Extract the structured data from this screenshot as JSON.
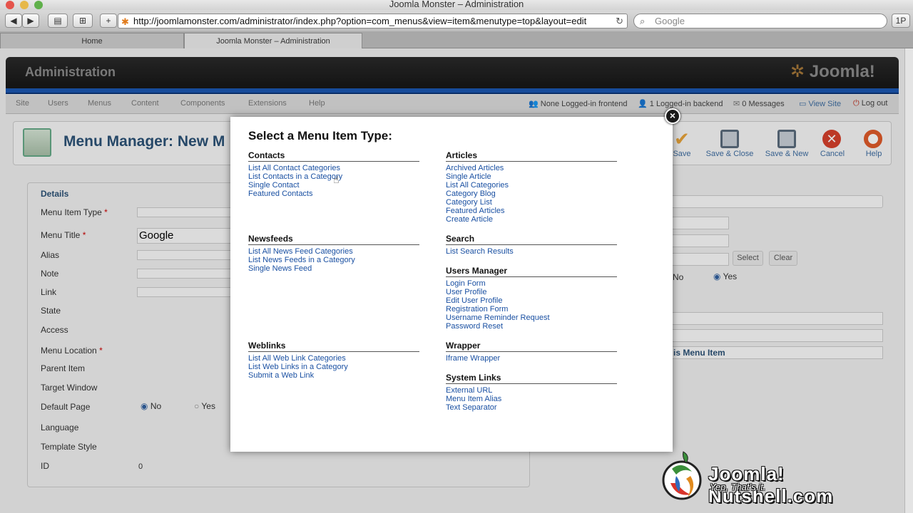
{
  "window": {
    "title": "Joomla Monster – Administration"
  },
  "browser": {
    "url": "http://joomlamonster.com/administrator/index.php?option=com_menus&view=item&menutype=top&layout=edit",
    "search_placeholder": "Google",
    "pp_label": "1P",
    "tabs": [
      {
        "label": "Home"
      },
      {
        "label": "Joomla Monster – Administration"
      }
    ]
  },
  "admin": {
    "header_title": "Administration",
    "logo_text": "Joomla!",
    "menu": [
      {
        "label": "Site"
      },
      {
        "label": "Users"
      },
      {
        "label": "Menus"
      },
      {
        "label": "Content"
      },
      {
        "label": "Components"
      },
      {
        "label": "Extensions"
      },
      {
        "label": "Help"
      }
    ],
    "status": {
      "frontend": "None Logged-in frontend",
      "backend": "1 Logged-in backend",
      "messages": "0 Messages",
      "view_site": "View Site",
      "logout": "Log out"
    },
    "page_title": "Menu Manager: New M",
    "toolbar": [
      {
        "label": "Save",
        "icon": "check-icon",
        "color": "#e8a33a"
      },
      {
        "label": "Save & Close",
        "icon": "save-icon",
        "color": "#5a6b7d"
      },
      {
        "label": "Save & New",
        "icon": "save-new-icon",
        "color": "#5a6b7d"
      },
      {
        "label": "Cancel",
        "icon": "cancel-icon",
        "color": "#d6402c"
      },
      {
        "label": "Help",
        "icon": "help-icon",
        "color": "#e05a2a"
      }
    ],
    "details": {
      "legend": "Details",
      "fields": [
        {
          "label": "Menu Item Type",
          "required": "*"
        },
        {
          "label": "Menu Title",
          "required": "*",
          "value": "Google"
        },
        {
          "label": "Alias"
        },
        {
          "label": "Note"
        },
        {
          "label": "Link"
        },
        {
          "label": "State"
        },
        {
          "label": "Access"
        },
        {
          "label": "Menu Location",
          "required": "*"
        },
        {
          "label": "Parent Item"
        },
        {
          "label": "Target Window"
        },
        {
          "label": "Default Page"
        },
        {
          "label": "Language"
        },
        {
          "label": "Template Style"
        },
        {
          "label": "ID"
        }
      ],
      "default_page_no": "No",
      "default_page_yes": "Yes",
      "id_value": "0"
    },
    "right": {
      "select_label": "Select",
      "clear_label": "Clear",
      "no_label": "No",
      "yes_label": "Yes",
      "section_label": "is Menu Item"
    }
  },
  "modal": {
    "title": "Select a Menu Item Type:",
    "close_label": "×",
    "groups": {
      "contacts": {
        "title": "Contacts",
        "items": [
          "List All Contact Categories",
          "List Contacts in a Category",
          "Single Contact",
          "Featured Contacts"
        ]
      },
      "newsfeeds": {
        "title": "Newsfeeds",
        "items": [
          "List All News Feed Categories",
          "List News Feeds in a Category",
          "Single News Feed"
        ]
      },
      "weblinks": {
        "title": "Weblinks",
        "items": [
          "List All Web Link Categories",
          "List Web Links in a Category",
          "Submit a Web Link"
        ]
      },
      "articles": {
        "title": "Articles",
        "items": [
          "Archived Articles",
          "Single Article",
          "List All Categories",
          "Category Blog",
          "Category List",
          "Featured Articles",
          "Create Article"
        ]
      },
      "search": {
        "title": "Search",
        "items": [
          "List Search Results"
        ]
      },
      "users": {
        "title": "Users Manager",
        "items": [
          "Login Form",
          "User Profile",
          "Edit User Profile",
          "Registration Form",
          "Username Reminder Request",
          "Password Reset"
        ]
      },
      "wrapper": {
        "title": "Wrapper",
        "items": [
          "Iframe Wrapper"
        ]
      },
      "system": {
        "title": "System Links",
        "items": [
          "External URL",
          "Menu Item Alias",
          "Text Separator"
        ]
      }
    }
  },
  "watermark": {
    "title": "Joomla! Nutshell.com",
    "tagline": "Yep, That's it."
  }
}
